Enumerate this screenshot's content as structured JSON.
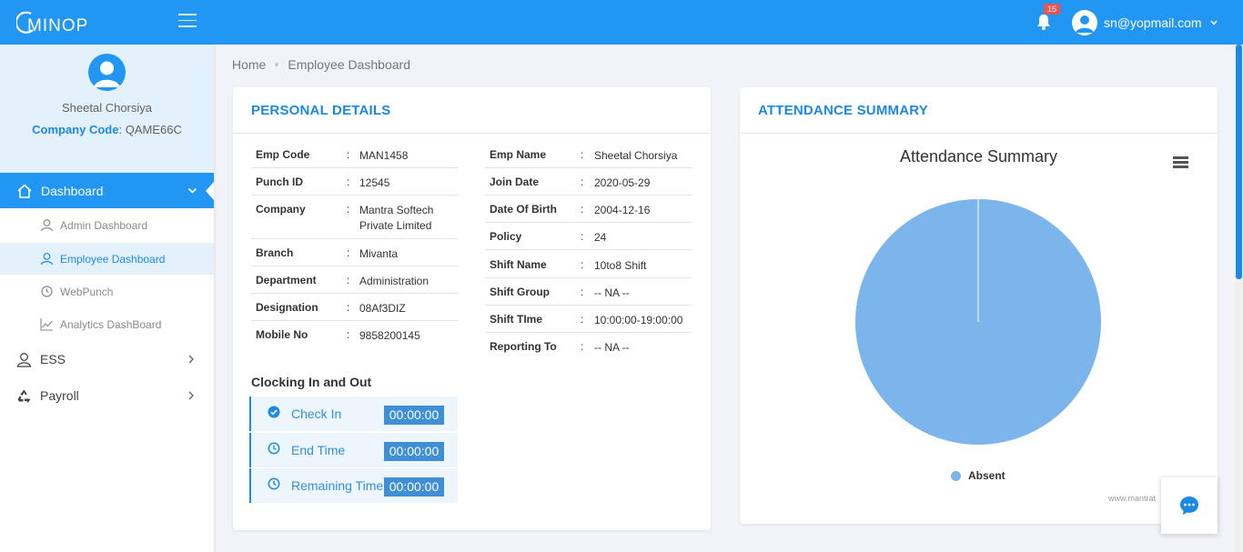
{
  "app": {
    "logo_text": "MINOP"
  },
  "colors": {
    "primary": "#2196f3",
    "accent": "#1e88e5",
    "sidebar_profile_bg": "#e2f1fc",
    "pie": "#7cb5ec",
    "badge": "#ef5350"
  },
  "header": {
    "notification_count": "15",
    "user_email": "sn@yopmail.com"
  },
  "sidebar": {
    "profile": {
      "name": "Sheetal Chorsiya",
      "company_code_label": "Company Code",
      "company_code_sep": ":",
      "company_code": "QAME66C"
    },
    "dashboard": {
      "label": "Dashboard",
      "sub_items": [
        {
          "label": "Admin Dashboard",
          "icon": "user-icon"
        },
        {
          "label": "Employee Dashboard",
          "icon": "user-icon",
          "active": true
        },
        {
          "label": "WebPunch",
          "icon": "clock-icon"
        },
        {
          "label": "Analytics DashBoard",
          "icon": "line-chart-icon"
        }
      ]
    },
    "items": [
      {
        "label": "ESS",
        "icon": "user-icon"
      },
      {
        "label": "Payroll",
        "icon": "recycle-icon"
      }
    ]
  },
  "breadcrumb": {
    "home": "Home",
    "current": "Employee Dashboard"
  },
  "personal_details": {
    "title": "PERSONAL DETAILS",
    "left": [
      {
        "key": "Emp Code",
        "value": "MAN1458"
      },
      {
        "key": "Punch ID",
        "value": "12545"
      },
      {
        "key": "Company",
        "value": "Mantra Softech Private Limited"
      },
      {
        "key": "Branch",
        "value": "Mivanta"
      },
      {
        "key": "Department",
        "value": "Administration"
      },
      {
        "key": "Designation",
        "value": "08Af3DIZ"
      },
      {
        "key": "Mobile No",
        "value": "9858200145"
      }
    ],
    "right": [
      {
        "key": "Emp Name",
        "value": "Sheetal Chorsiya"
      },
      {
        "key": "Join Date",
        "value": "2020-05-29"
      },
      {
        "key": "Date Of Birth",
        "value": "2004-12-16"
      },
      {
        "key": "Policy",
        "value": "24"
      },
      {
        "key": "Shift Name",
        "value": "10to8 Shift"
      },
      {
        "key": "Shift Group",
        "value": "-- NA --"
      },
      {
        "key": "Shift TIme",
        "value": "10:00:00-19:00:00"
      },
      {
        "key": "Reporting To",
        "value": "-- NA --"
      }
    ],
    "colon": ":",
    "clocking": {
      "title": "Clocking In and Out",
      "rows": [
        {
          "label": "Check In",
          "time": "00:00:00",
          "icon": "check-circle-icon"
        },
        {
          "label": "End Time",
          "time": "00:00:00",
          "icon": "clock-icon"
        },
        {
          "label": "Remaining Time",
          "time": "00:00:00",
          "icon": "clock-icon"
        }
      ]
    }
  },
  "attendance": {
    "title": "ATTENDANCE SUMMARY",
    "credits": "www.mantrat"
  },
  "chart_data": {
    "type": "pie",
    "title": "Attendance Summary",
    "slices": [
      {
        "name": "Absent",
        "value": 100,
        "color": "#7cb5ec"
      }
    ],
    "legend_position": "bottom"
  }
}
